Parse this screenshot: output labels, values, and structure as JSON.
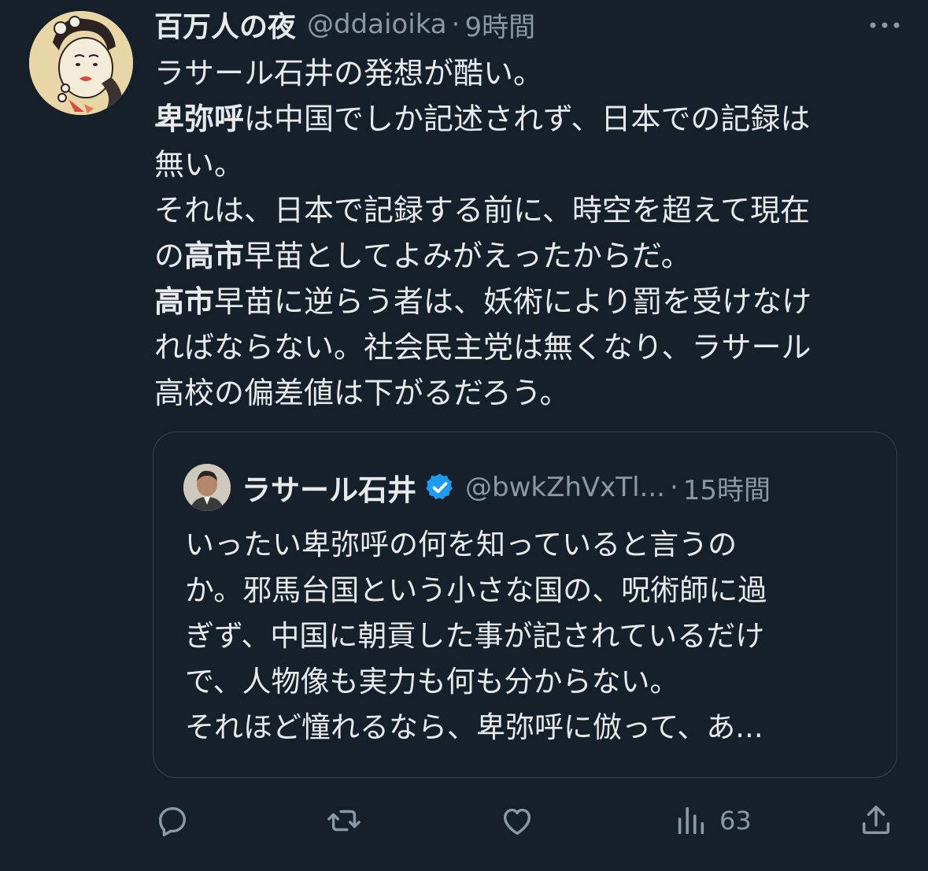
{
  "tweet": {
    "author_name": "百万人の夜",
    "handle": "@ddaioika",
    "separator": "·",
    "time": "9時間",
    "body_lines": [
      [
        {
          "text": "ラサール石井の発想が酷い。",
          "bold": false
        }
      ],
      [
        {
          "text": "卑弥呼",
          "bold": true
        },
        {
          "text": "は中国でしか記述されず、日本での記録は",
          "bold": false
        }
      ],
      [
        {
          "text": "無い。",
          "bold": false
        }
      ],
      [
        {
          "text": "それは、日本で記録する前に、時空を超えて現在",
          "bold": false
        }
      ],
      [
        {
          "text": "の",
          "bold": false
        },
        {
          "text": "高市",
          "bold": true
        },
        {
          "text": "早苗としてよみがえったからだ。",
          "bold": false
        }
      ],
      [
        {
          "text": "高市",
          "bold": true
        },
        {
          "text": "早苗に逆らう者は、妖術により罰を受けなけ",
          "bold": false
        }
      ],
      [
        {
          "text": "ればならない。社会民主党は無くなり、ラサール",
          "bold": false
        }
      ],
      [
        {
          "text": "高校の偏差値は下がるだろう。",
          "bold": false
        }
      ]
    ]
  },
  "quoted": {
    "author_name": "ラサール石井",
    "handle": "@bwkZhVxTl...",
    "separator": "·",
    "time": "15時間",
    "body_lines": [
      "いったい卑弥呼の何を知っていると言うの",
      "か。邪馬台国という小さな国の、呪術師に過",
      "ぎず、中国に朝貢した事が記されているだけ",
      "で、人物像も実力も何も分からない。",
      "それほど憧れるなら、卑弥呼に倣って、あ..."
    ]
  },
  "actions": {
    "views": "63"
  },
  "icons": [
    "more-icon",
    "verified-badge-icon",
    "reply-icon",
    "retweet-icon",
    "like-icon",
    "views-icon",
    "share-icon"
  ],
  "colors": {
    "background": "#15202b",
    "text": "#e7e9ea",
    "secondary": "#8b98a5",
    "border": "#38444d",
    "verified": "#1d9bf0"
  }
}
